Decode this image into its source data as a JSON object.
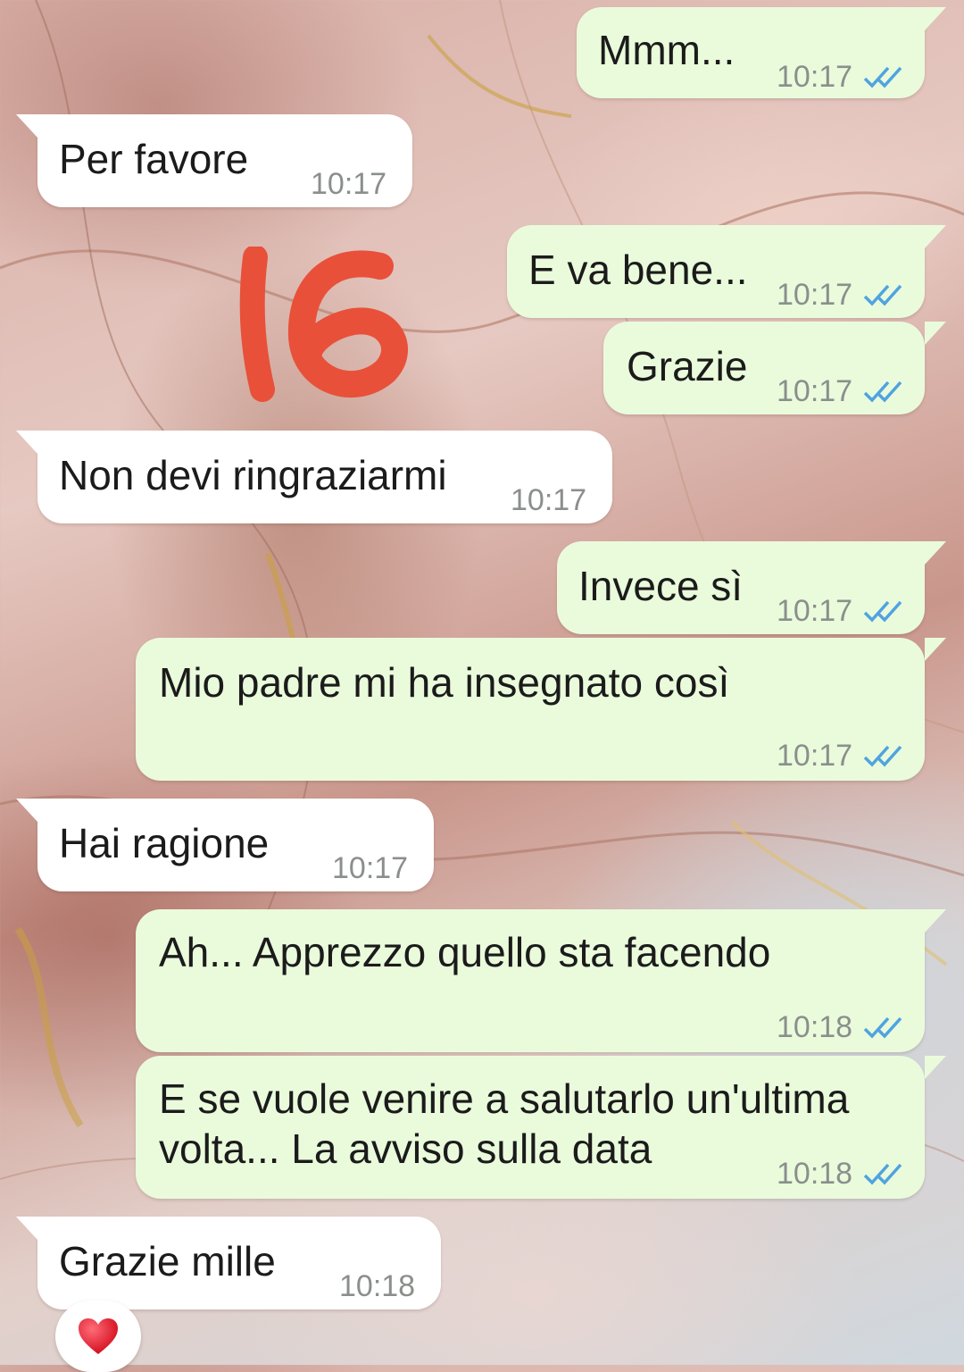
{
  "colors": {
    "outgoing_bubble": "#eafbdc",
    "incoming_bubble": "#ffffff",
    "read_ticks": "#4fa3e0",
    "sticker": "#e8503a",
    "heart": "#e0182d"
  },
  "sticker": {
    "text": "16",
    "icon": "handwritten-number-sticker"
  },
  "messages": [
    {
      "direction": "out",
      "text": "Mmm...",
      "time": "10:17",
      "status": "read"
    },
    {
      "direction": "in",
      "text": "Per favore",
      "time": "10:17"
    },
    {
      "direction": "out",
      "text": "E va bene...",
      "time": "10:17",
      "status": "read"
    },
    {
      "direction": "out",
      "text": "Grazie",
      "time": "10:17",
      "status": "read"
    },
    {
      "direction": "in",
      "text": "Non devi ringraziarmi",
      "time": "10:17"
    },
    {
      "direction": "out",
      "text": "Invece sì",
      "time": "10:17",
      "status": "read"
    },
    {
      "direction": "out",
      "text": "Mio padre mi ha insegnato così",
      "time": "10:17",
      "status": "read"
    },
    {
      "direction": "in",
      "text": "Hai ragione",
      "time": "10:17"
    },
    {
      "direction": "out",
      "text": "Ah... Apprezzo quello sta facendo",
      "time": "10:18",
      "status": "read"
    },
    {
      "direction": "out",
      "text": "E se vuole venire a salutarlo un'ultima\nvolta... La avviso sulla data",
      "time": "10:18",
      "status": "read"
    },
    {
      "direction": "in",
      "text": "Grazie mille",
      "time": "10:18"
    }
  ],
  "reaction": {
    "icon": "red-heart-icon",
    "emoji": "❤"
  }
}
